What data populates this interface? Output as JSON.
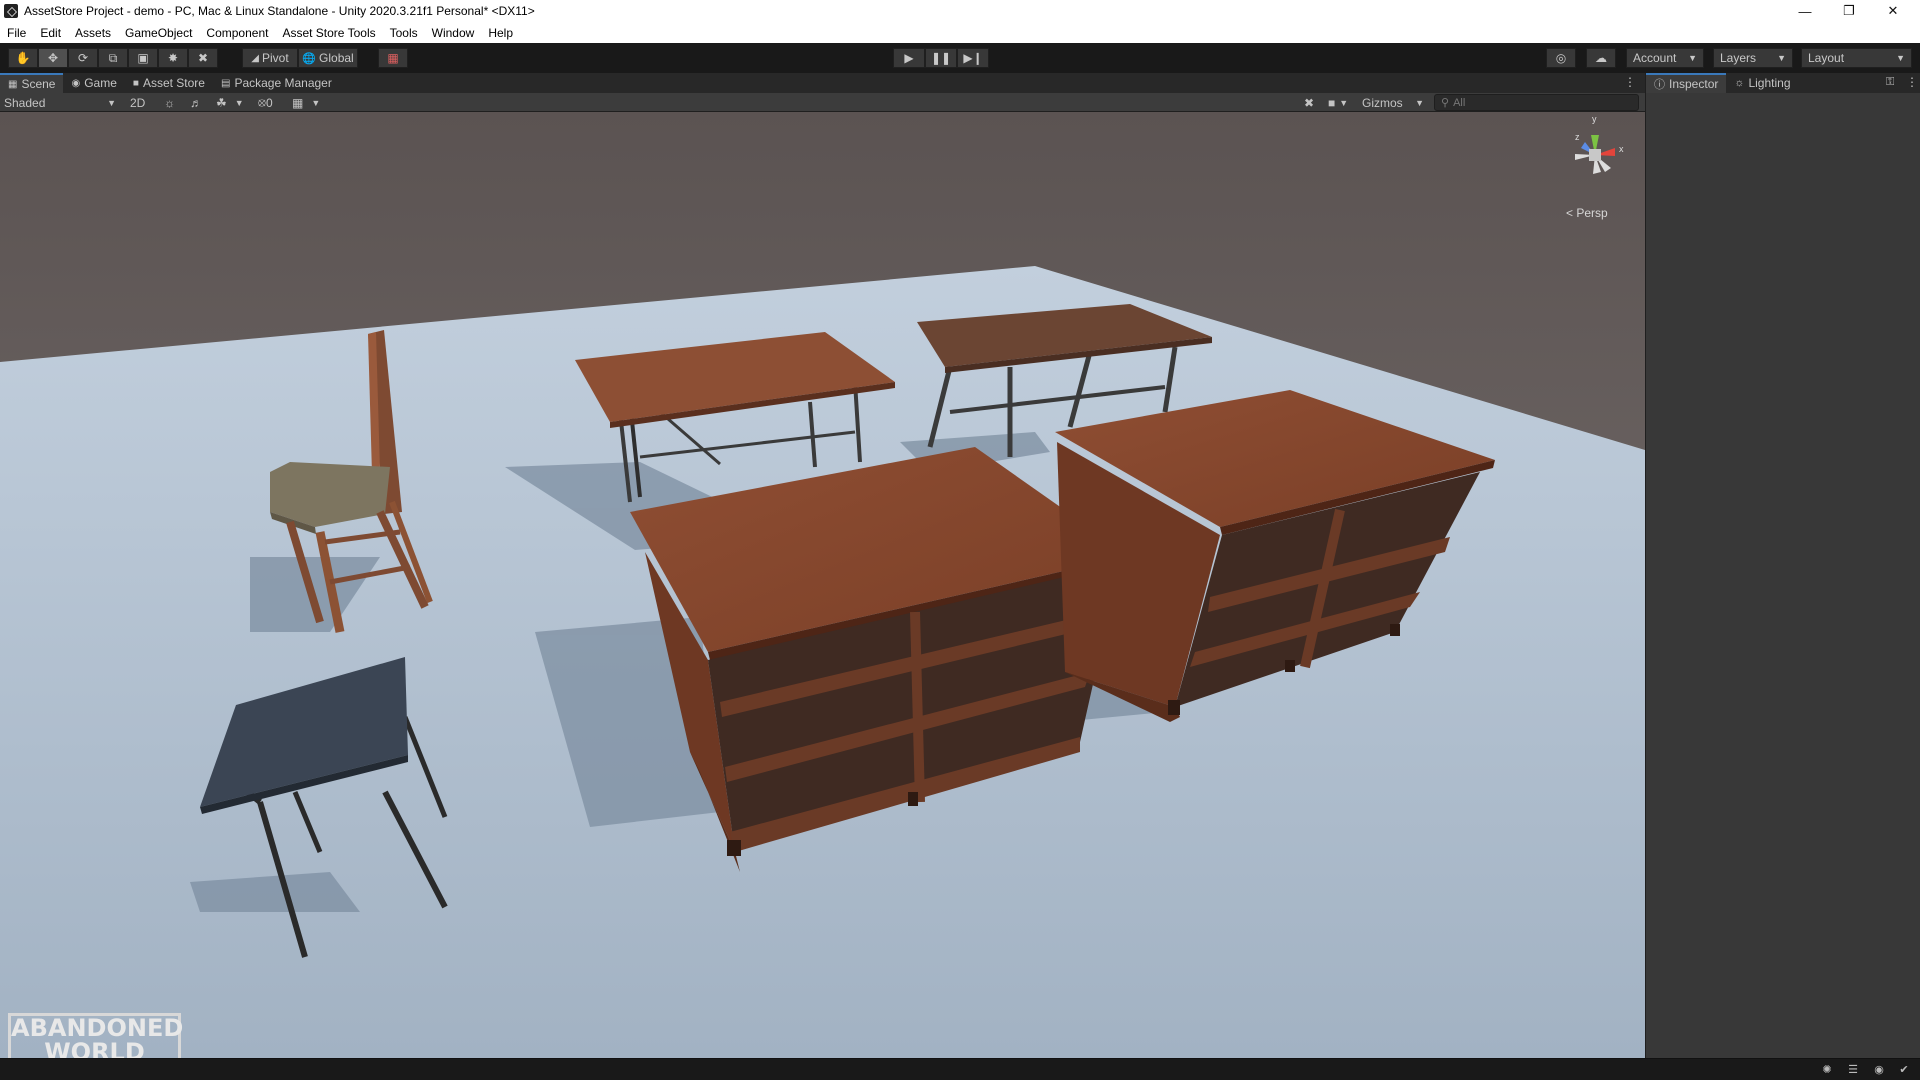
{
  "window": {
    "title": "AssetStore Project - demo - PC, Mac & Linux Standalone - Unity 2020.3.21f1 Personal* <DX11>",
    "controls": [
      "minimize-icon",
      "restore-icon",
      "close-icon"
    ]
  },
  "menu": {
    "items": [
      "File",
      "Edit",
      "Assets",
      "GameObject",
      "Component",
      "Asset Store Tools",
      "Tools",
      "Window",
      "Help"
    ]
  },
  "toolbar": {
    "tools": [
      "hand-icon",
      "move-icon",
      "rotate-icon",
      "scale-icon",
      "rect-icon",
      "transform-icon",
      "custom-tool-icon"
    ],
    "active_tool": "move-icon",
    "pivot_label": "Pivot",
    "global_label": "Global",
    "account_label": "Account",
    "layers_label": "Layers",
    "layout_label": "Layout"
  },
  "tabs": {
    "scene": "Scene",
    "game": "Game",
    "asset_store": "Asset Store",
    "package_manager": "Package Manager"
  },
  "scene_bar": {
    "shading_mode": "Shaded",
    "mode_2d": "2D",
    "hidden_count": "0",
    "gizmos_label": "Gizmos",
    "search_placeholder": "All"
  },
  "viewport": {
    "projection_label": "< Persp",
    "axis_labels": {
      "y": "y",
      "x": "x",
      "z": "z"
    },
    "colors": {
      "sky_top": "#5a5251",
      "sky_horizon": "#7a7371",
      "ground": "#a9b9c9",
      "wood": "#8a4a30",
      "metal_desk_top": "#3b4554"
    }
  },
  "inspector": {
    "tab_inspector": "Inspector",
    "tab_lighting": "Lighting"
  },
  "watermark": {
    "line1": "ABANDONED",
    "line2": "WORLD"
  }
}
